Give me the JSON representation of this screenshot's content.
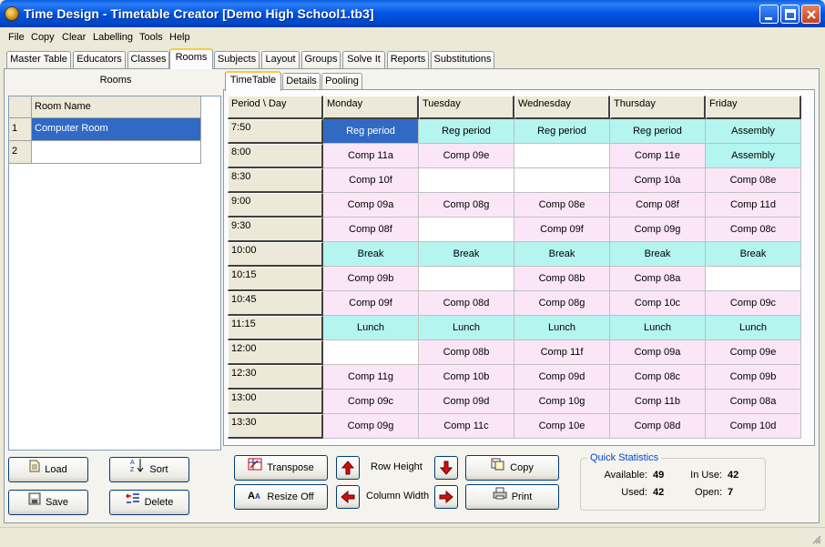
{
  "window": {
    "title": "Time Design - Timetable Creator [Demo High School1.tb3]"
  },
  "menu": [
    "File",
    "Copy",
    "Clear",
    "Labelling",
    "Tools",
    "Help"
  ],
  "tabs": [
    "Master Table",
    "Educators",
    "Classes",
    "Rooms",
    "Subjects",
    "Layout",
    "Groups",
    "Solve It",
    "Reports",
    "Substitutions"
  ],
  "active_tab": "Rooms",
  "rooms_panel": {
    "header": "Rooms",
    "column_header": "Room Name",
    "rows": [
      {
        "num": "1",
        "name": "Computer Room",
        "selected": true
      },
      {
        "num": "2",
        "name": "",
        "selected": false
      }
    ],
    "buttons": {
      "load": "Load",
      "sort": "Sort",
      "save": "Save",
      "delete": "Delete"
    }
  },
  "inner_tabs": [
    "TimeTable",
    "Details",
    "Pooling"
  ],
  "timetable": {
    "corner": "Period \\ Day",
    "days": [
      "Monday",
      "Tuesday",
      "Wednesday",
      "Thursday",
      "Friday"
    ],
    "rows": [
      {
        "period": "7:50",
        "cells": [
          {
            "t": "Reg period",
            "c": "sel"
          },
          {
            "t": "Reg period",
            "c": "cyan"
          },
          {
            "t": "Reg period",
            "c": "cyan"
          },
          {
            "t": "Reg period",
            "c": "cyan"
          },
          {
            "t": "Assembly",
            "c": "cyan"
          }
        ]
      },
      {
        "period": "8:00",
        "cells": [
          {
            "t": "Comp 11a",
            "c": "pink"
          },
          {
            "t": "Comp 09e",
            "c": "pink"
          },
          {
            "t": "",
            "c": "white"
          },
          {
            "t": "Comp 11e",
            "c": "pink"
          },
          {
            "t": "Assembly",
            "c": "cyan"
          }
        ]
      },
      {
        "period": "8:30",
        "cells": [
          {
            "t": "Comp 10f",
            "c": "pink"
          },
          {
            "t": "",
            "c": "white"
          },
          {
            "t": "",
            "c": "white"
          },
          {
            "t": "Comp 10a",
            "c": "pink"
          },
          {
            "t": "Comp 08e",
            "c": "pink"
          }
        ]
      },
      {
        "period": "9:00",
        "cells": [
          {
            "t": "Comp 09a",
            "c": "pink"
          },
          {
            "t": "Comp 08g",
            "c": "pink"
          },
          {
            "t": "Comp 08e",
            "c": "pink"
          },
          {
            "t": "Comp 08f",
            "c": "pink"
          },
          {
            "t": "Comp 11d",
            "c": "pink"
          }
        ]
      },
      {
        "period": "9:30",
        "cells": [
          {
            "t": "Comp 08f",
            "c": "pink"
          },
          {
            "t": "",
            "c": "white"
          },
          {
            "t": "Comp 09f",
            "c": "pink"
          },
          {
            "t": "Comp 09g",
            "c": "pink"
          },
          {
            "t": "Comp 08c",
            "c": "pink"
          }
        ]
      },
      {
        "period": "10:00",
        "cells": [
          {
            "t": "Break",
            "c": "cyan"
          },
          {
            "t": "Break",
            "c": "cyan"
          },
          {
            "t": "Break",
            "c": "cyan"
          },
          {
            "t": "Break",
            "c": "cyan"
          },
          {
            "t": "Break",
            "c": "cyan"
          }
        ]
      },
      {
        "period": "10:15",
        "cells": [
          {
            "t": "Comp 09b",
            "c": "pink"
          },
          {
            "t": "",
            "c": "white"
          },
          {
            "t": "Comp 08b",
            "c": "pink"
          },
          {
            "t": "Comp 08a",
            "c": "pink"
          },
          {
            "t": "",
            "c": "white"
          }
        ]
      },
      {
        "period": "10:45",
        "cells": [
          {
            "t": "Comp 09f",
            "c": "pink"
          },
          {
            "t": "Comp 08d",
            "c": "pink"
          },
          {
            "t": "Comp 08g",
            "c": "pink"
          },
          {
            "t": "Comp 10c",
            "c": "pink"
          },
          {
            "t": "Comp 09c",
            "c": "pink"
          }
        ]
      },
      {
        "period": "11:15",
        "cells": [
          {
            "t": "Lunch",
            "c": "cyan"
          },
          {
            "t": "Lunch",
            "c": "cyan"
          },
          {
            "t": "Lunch",
            "c": "cyan"
          },
          {
            "t": "Lunch",
            "c": "cyan"
          },
          {
            "t": "Lunch",
            "c": "cyan"
          }
        ]
      },
      {
        "period": "12:00",
        "cells": [
          {
            "t": "",
            "c": "white"
          },
          {
            "t": "Comp 08b",
            "c": "pink"
          },
          {
            "t": "Comp 11f",
            "c": "pink"
          },
          {
            "t": "Comp 09a",
            "c": "pink"
          },
          {
            "t": "Comp 09e",
            "c": "pink"
          }
        ]
      },
      {
        "period": "12:30",
        "cells": [
          {
            "t": "Comp 11g",
            "c": "pink"
          },
          {
            "t": "Comp 10b",
            "c": "pink"
          },
          {
            "t": "Comp 09d",
            "c": "pink"
          },
          {
            "t": "Comp 08c",
            "c": "pink"
          },
          {
            "t": "Comp 09b",
            "c": "pink"
          }
        ]
      },
      {
        "period": "13:00",
        "cells": [
          {
            "t": "Comp 09c",
            "c": "pink"
          },
          {
            "t": "Comp 09d",
            "c": "pink"
          },
          {
            "t": "Comp 10g",
            "c": "pink"
          },
          {
            "t": "Comp 11b",
            "c": "pink"
          },
          {
            "t": "Comp 08a",
            "c": "pink"
          }
        ]
      },
      {
        "period": "13:30",
        "cells": [
          {
            "t": "Comp 09g",
            "c": "pink"
          },
          {
            "t": "Comp 11c",
            "c": "pink"
          },
          {
            "t": "Comp 10e",
            "c": "pink"
          },
          {
            "t": "Comp 08d",
            "c": "pink"
          },
          {
            "t": "Comp 10d",
            "c": "pink"
          }
        ]
      }
    ]
  },
  "controls": {
    "transpose": "Transpose",
    "resize_off": "Resize Off",
    "row_height": "Row Height",
    "column_width": "Column Width",
    "copy": "Copy",
    "print": "Print"
  },
  "quick_stats": {
    "title": "Quick Statistics",
    "available_label": "Available:",
    "available": "49",
    "in_use_label": "In Use:",
    "in_use": "42",
    "used_label": "Used:",
    "used": "42",
    "open_label": "Open:",
    "open": "7"
  },
  "colors": {
    "selected": "#316ac5",
    "cyan": "#b4f5f0",
    "pink": "#fbe6f8",
    "white": "#ffffff",
    "arrow_red": "#d01010"
  }
}
